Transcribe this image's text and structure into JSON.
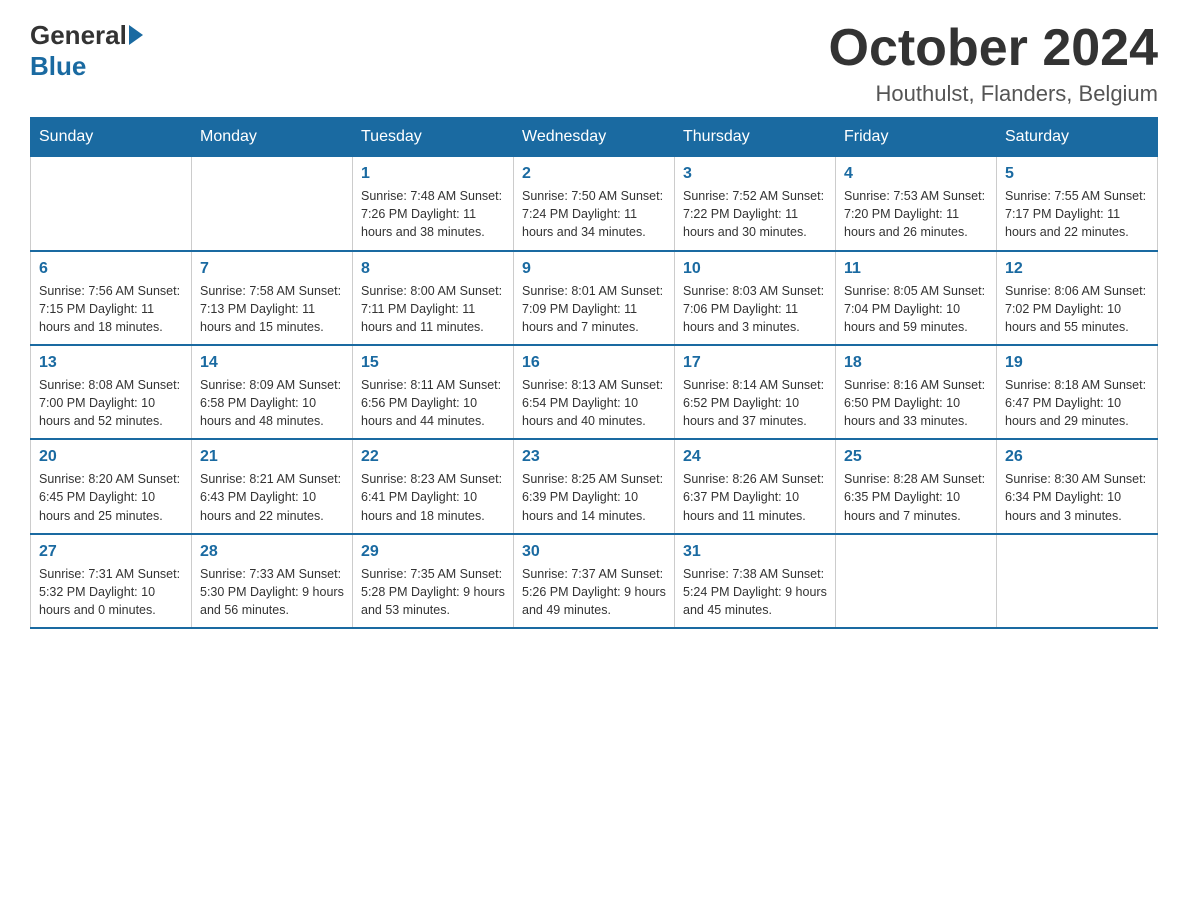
{
  "header": {
    "logo_general": "General",
    "logo_blue": "Blue",
    "month_title": "October 2024",
    "location": "Houthulst, Flanders, Belgium"
  },
  "days_of_week": [
    "Sunday",
    "Monday",
    "Tuesday",
    "Wednesday",
    "Thursday",
    "Friday",
    "Saturday"
  ],
  "weeks": [
    [
      {
        "day": "",
        "info": ""
      },
      {
        "day": "",
        "info": ""
      },
      {
        "day": "1",
        "info": "Sunrise: 7:48 AM\nSunset: 7:26 PM\nDaylight: 11 hours\nand 38 minutes."
      },
      {
        "day": "2",
        "info": "Sunrise: 7:50 AM\nSunset: 7:24 PM\nDaylight: 11 hours\nand 34 minutes."
      },
      {
        "day": "3",
        "info": "Sunrise: 7:52 AM\nSunset: 7:22 PM\nDaylight: 11 hours\nand 30 minutes."
      },
      {
        "day": "4",
        "info": "Sunrise: 7:53 AM\nSunset: 7:20 PM\nDaylight: 11 hours\nand 26 minutes."
      },
      {
        "day": "5",
        "info": "Sunrise: 7:55 AM\nSunset: 7:17 PM\nDaylight: 11 hours\nand 22 minutes."
      }
    ],
    [
      {
        "day": "6",
        "info": "Sunrise: 7:56 AM\nSunset: 7:15 PM\nDaylight: 11 hours\nand 18 minutes."
      },
      {
        "day": "7",
        "info": "Sunrise: 7:58 AM\nSunset: 7:13 PM\nDaylight: 11 hours\nand 15 minutes."
      },
      {
        "day": "8",
        "info": "Sunrise: 8:00 AM\nSunset: 7:11 PM\nDaylight: 11 hours\nand 11 minutes."
      },
      {
        "day": "9",
        "info": "Sunrise: 8:01 AM\nSunset: 7:09 PM\nDaylight: 11 hours\nand 7 minutes."
      },
      {
        "day": "10",
        "info": "Sunrise: 8:03 AM\nSunset: 7:06 PM\nDaylight: 11 hours\nand 3 minutes."
      },
      {
        "day": "11",
        "info": "Sunrise: 8:05 AM\nSunset: 7:04 PM\nDaylight: 10 hours\nand 59 minutes."
      },
      {
        "day": "12",
        "info": "Sunrise: 8:06 AM\nSunset: 7:02 PM\nDaylight: 10 hours\nand 55 minutes."
      }
    ],
    [
      {
        "day": "13",
        "info": "Sunrise: 8:08 AM\nSunset: 7:00 PM\nDaylight: 10 hours\nand 52 minutes."
      },
      {
        "day": "14",
        "info": "Sunrise: 8:09 AM\nSunset: 6:58 PM\nDaylight: 10 hours\nand 48 minutes."
      },
      {
        "day": "15",
        "info": "Sunrise: 8:11 AM\nSunset: 6:56 PM\nDaylight: 10 hours\nand 44 minutes."
      },
      {
        "day": "16",
        "info": "Sunrise: 8:13 AM\nSunset: 6:54 PM\nDaylight: 10 hours\nand 40 minutes."
      },
      {
        "day": "17",
        "info": "Sunrise: 8:14 AM\nSunset: 6:52 PM\nDaylight: 10 hours\nand 37 minutes."
      },
      {
        "day": "18",
        "info": "Sunrise: 8:16 AM\nSunset: 6:50 PM\nDaylight: 10 hours\nand 33 minutes."
      },
      {
        "day": "19",
        "info": "Sunrise: 8:18 AM\nSunset: 6:47 PM\nDaylight: 10 hours\nand 29 minutes."
      }
    ],
    [
      {
        "day": "20",
        "info": "Sunrise: 8:20 AM\nSunset: 6:45 PM\nDaylight: 10 hours\nand 25 minutes."
      },
      {
        "day": "21",
        "info": "Sunrise: 8:21 AM\nSunset: 6:43 PM\nDaylight: 10 hours\nand 22 minutes."
      },
      {
        "day": "22",
        "info": "Sunrise: 8:23 AM\nSunset: 6:41 PM\nDaylight: 10 hours\nand 18 minutes."
      },
      {
        "day": "23",
        "info": "Sunrise: 8:25 AM\nSunset: 6:39 PM\nDaylight: 10 hours\nand 14 minutes."
      },
      {
        "day": "24",
        "info": "Sunrise: 8:26 AM\nSunset: 6:37 PM\nDaylight: 10 hours\nand 11 minutes."
      },
      {
        "day": "25",
        "info": "Sunrise: 8:28 AM\nSunset: 6:35 PM\nDaylight: 10 hours\nand 7 minutes."
      },
      {
        "day": "26",
        "info": "Sunrise: 8:30 AM\nSunset: 6:34 PM\nDaylight: 10 hours\nand 3 minutes."
      }
    ],
    [
      {
        "day": "27",
        "info": "Sunrise: 7:31 AM\nSunset: 5:32 PM\nDaylight: 10 hours\nand 0 minutes."
      },
      {
        "day": "28",
        "info": "Sunrise: 7:33 AM\nSunset: 5:30 PM\nDaylight: 9 hours\nand 56 minutes."
      },
      {
        "day": "29",
        "info": "Sunrise: 7:35 AM\nSunset: 5:28 PM\nDaylight: 9 hours\nand 53 minutes."
      },
      {
        "day": "30",
        "info": "Sunrise: 7:37 AM\nSunset: 5:26 PM\nDaylight: 9 hours\nand 49 minutes."
      },
      {
        "day": "31",
        "info": "Sunrise: 7:38 AM\nSunset: 5:24 PM\nDaylight: 9 hours\nand 45 minutes."
      },
      {
        "day": "",
        "info": ""
      },
      {
        "day": "",
        "info": ""
      }
    ]
  ]
}
